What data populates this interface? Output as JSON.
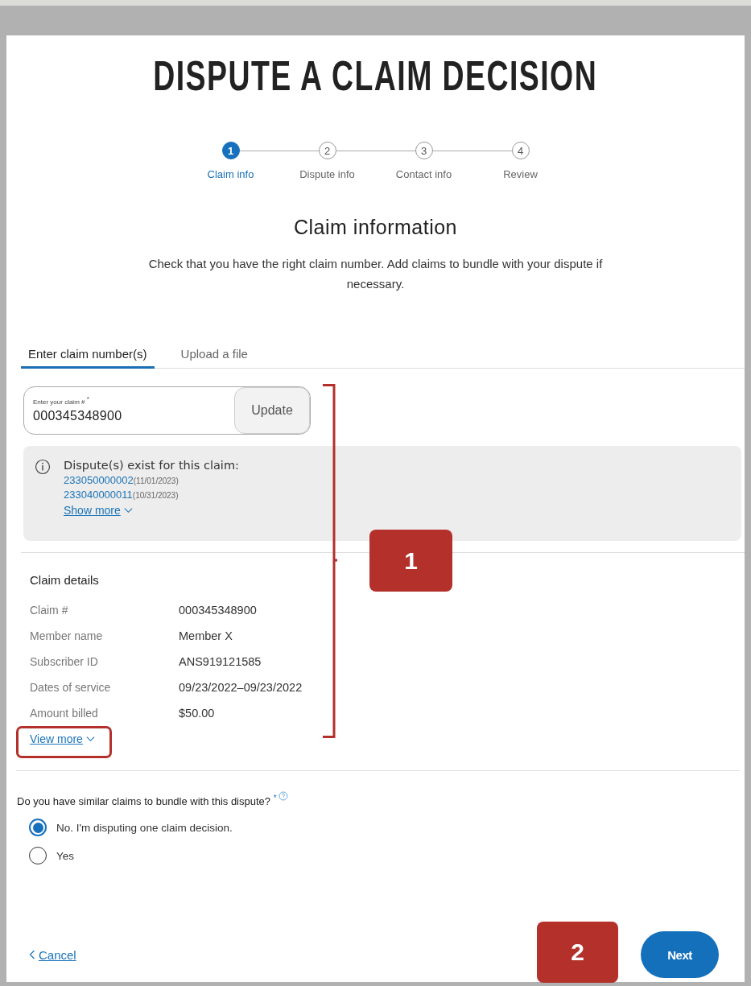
{
  "title": "DISPUTE A CLAIM DECISION",
  "steps": [
    {
      "number": "1",
      "label": "Claim info",
      "selected": true
    },
    {
      "number": "2",
      "label": "Dispute info",
      "selected": false
    },
    {
      "number": "3",
      "label": "Contact info",
      "selected": false
    },
    {
      "number": "4",
      "label": "Review",
      "selected": false
    }
  ],
  "section_title": "Claim information",
  "description": "Check that you have the right claim number. Add claims to bundle with your dispute if necessary.",
  "tabs": [
    {
      "label": "Enter claim number(s)",
      "selected": true
    },
    {
      "label": "Upload a file",
      "selected": false
    }
  ],
  "claim_field": {
    "label": "Enter your claim #",
    "required_mark": "*",
    "value": "000345348900",
    "button": "Update"
  },
  "notice": {
    "title": "Dispute(s) exist for this claim:",
    "disputes": [
      {
        "number": "233050000002",
        "date": "(11/01/2023)"
      },
      {
        "number": "233040000011",
        "date": "(10/31/2023)"
      }
    ],
    "show_more": "Show more"
  },
  "claim_details": {
    "heading": "Claim details",
    "rows": [
      {
        "label": "Claim #",
        "value": "000345348900"
      },
      {
        "label": "Member name",
        "value": "Member X"
      },
      {
        "label": "Subscriber ID",
        "value": "ANS919121585"
      },
      {
        "label": "Dates of service",
        "value": "09/23/2022–09/23/2022"
      },
      {
        "label": "Amount billed",
        "value": "$50.00"
      }
    ],
    "view_more": "View more"
  },
  "question": {
    "text": "Do you have similar claims to bundle with this dispute?",
    "required_mark": "*",
    "options": [
      {
        "label": "No. I'm disputing one claim decision.",
        "selected": true
      },
      {
        "label": "Yes",
        "selected": false
      }
    ]
  },
  "footer": {
    "cancel": "Cancel",
    "next": "Next"
  },
  "annotations": [
    {
      "label": "1"
    },
    {
      "label": "2"
    }
  ]
}
